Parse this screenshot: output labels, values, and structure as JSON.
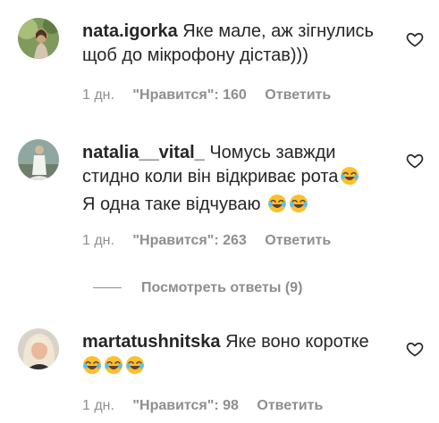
{
  "comments": [
    {
      "username": "nata.igorka",
      "text_line1": "Яке мале, аж зігнулись",
      "text_line2": "щоб до мікрофону дістав)))",
      "age": "1 дн.",
      "likes_label": "\"Нравится\": 160",
      "reply_label": "Ответить"
    },
    {
      "username": "natalia__vital_",
      "text_line1": "Чомусь завжди",
      "text_line2": "стидно коли він відкриває рота",
      "text_line3": "Я одна таке відчуваю",
      "age": "1 дн.",
      "likes_label": "\"Нравится\": 263",
      "reply_label": "Ответить"
    },
    {
      "username": "martatushnitska",
      "text_line1": "Яке воно коротке",
      "age": "1 дн.",
      "likes_label": "\"Нравится\": 98",
      "reply_label": "Ответить"
    }
  ],
  "view_replies_label": "Посмотреть ответы (9)",
  "icons": {
    "like": "heart-outline-icon",
    "emoji": "face-with-tears-of-joy-icon"
  },
  "colors": {
    "text": "#262626",
    "secondary": "#8e8e8e",
    "background": "#ffffff"
  }
}
